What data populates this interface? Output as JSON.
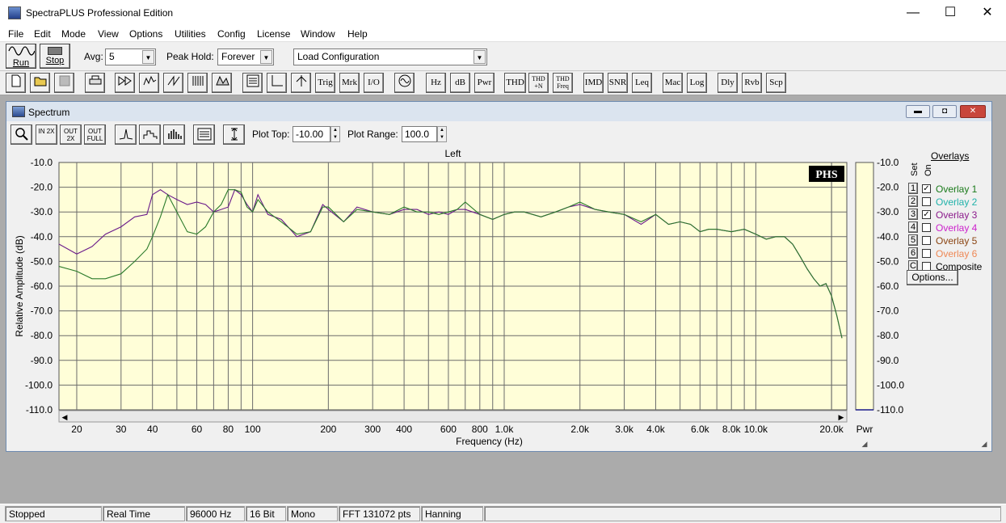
{
  "window": {
    "title": "SpectraPLUS Professional Edition",
    "minimize": "—",
    "maximize": "☐",
    "close": "✕"
  },
  "menu": [
    "File",
    "Edit",
    "Mode",
    "View",
    "Options",
    "Utilities",
    "Config",
    "License",
    "Window",
    "Help"
  ],
  "toolbar": {
    "run_label": "Run",
    "stop_label": "Stop",
    "avg_label": "Avg:",
    "avg_value": "5",
    "peak_hold_label": "Peak Hold:",
    "peak_hold_value": "Forever",
    "config_value": "Load Configuration"
  },
  "toolbar2": {
    "trig": "Trig",
    "mrk": "Mrk",
    "io": "I/O",
    "hz": "Hz",
    "db": "dB",
    "pwr": "Pwr",
    "thd": "THD",
    "thdn": "THD +N",
    "thdfreq": "THD Freq",
    "imd": "IMD",
    "snr": "SNR",
    "leq": "Leq",
    "mac": "Mac",
    "log": "Log",
    "dly": "Dly",
    "rvb": "Rvb",
    "scp": "Scp"
  },
  "spectrum": {
    "title": "Spectrum",
    "plot_top_label": "Plot Top:",
    "plot_top_value": "-10.00",
    "plot_range_label": "Plot Range:",
    "plot_range_value": "100.0",
    "channel_label": "Left",
    "logo": "PHS",
    "pwr_label": "Pwr",
    "zoom_labels": {
      "zin": "IN 2X",
      "zout": "OUT 2X",
      "zfull": "OUT FULL"
    }
  },
  "overlays": {
    "header": "Overlays",
    "set_label": "Set",
    "on_label": "On",
    "options_label": "Options...",
    "items": [
      {
        "num": "1",
        "name": "Overlay 1",
        "checked": true,
        "color": "#1a7a1a"
      },
      {
        "num": "2",
        "name": "Overlay 2",
        "checked": false,
        "color": "#20b2aa"
      },
      {
        "num": "3",
        "name": "Overlay 3",
        "checked": true,
        "color": "#8b1a8b"
      },
      {
        "num": "4",
        "name": "Overlay 4",
        "checked": false,
        "color": "#cc22cc"
      },
      {
        "num": "5",
        "name": "Overlay 5",
        "checked": false,
        "color": "#8b4513"
      },
      {
        "num": "6",
        "name": "Overlay 6",
        "checked": false,
        "color": "#ee8855"
      },
      {
        "num": "C",
        "name": "Composite",
        "checked": false,
        "color": "#000000"
      }
    ]
  },
  "status": [
    "Stopped",
    "Real Time",
    "96000 Hz",
    "16 Bit",
    "Mono",
    "FFT 131072 pts",
    "Hanning"
  ],
  "chart_data": {
    "type": "line",
    "title": "Left",
    "xlabel": "Frequency (Hz)",
    "ylabel": "Relative Amplitude (dB)",
    "xscale": "log",
    "xlim": [
      17,
      23000
    ],
    "ylim": [
      -110,
      -10
    ],
    "x_ticks": [
      "20",
      "30",
      "40",
      "60",
      "80",
      "100",
      "200",
      "300",
      "400",
      "600",
      "800",
      "1.0k",
      "2.0k",
      "3.0k",
      "4.0k",
      "6.0k",
      "8.0k",
      "10.0k",
      "20.0k"
    ],
    "y_ticks": [
      "-10.0",
      "-20.0",
      "-30.0",
      "-40.0",
      "-50.0",
      "-60.0",
      "-70.0",
      "-80.0",
      "-90.0",
      "-100.0",
      "-110.0"
    ],
    "grid": true,
    "background": "#fffed8",
    "series": [
      {
        "name": "Overlay 3",
        "color": "#6a1a8a",
        "x": [
          17,
          20,
          23,
          26,
          30,
          34,
          38,
          40,
          43,
          46,
          50,
          55,
          60,
          65,
          70,
          75,
          80,
          85,
          90,
          95,
          100,
          105,
          115,
          130,
          150,
          170,
          190,
          200,
          230,
          260,
          300,
          350,
          400,
          450,
          500,
          550,
          600,
          650,
          700,
          800,
          900,
          1000,
          1100,
          1200,
          1400,
          1600,
          1800,
          2000,
          2300,
          2600,
          3000,
          3500,
          4000,
          4500,
          5000,
          5500,
          6000,
          6500,
          7000,
          8000,
          9000,
          10000,
          11000,
          12000,
          13000,
          14000,
          15000,
          16000,
          17000,
          18000,
          19000,
          20000,
          21000,
          22000
        ],
        "y": [
          -43,
          -47,
          -44,
          -39,
          -36,
          -32,
          -31,
          -23,
          -21,
          -23,
          -25,
          -27,
          -26,
          -27,
          -30,
          -29,
          -28,
          -21,
          -23,
          -27,
          -30,
          -23,
          -31,
          -33,
          -40,
          -38,
          -27,
          -29,
          -34,
          -28,
          -30,
          -31,
          -29,
          -29,
          -31,
          -30,
          -31,
          -29,
          -29,
          -31,
          -33,
          -31,
          -30,
          -30,
          -32,
          -30,
          -28,
          -27,
          -29,
          -30,
          -31,
          -35,
          -31,
          -35,
          -34,
          -35,
          -38,
          -37,
          -37,
          -38,
          -37,
          -39,
          -41,
          -40,
          -40,
          -43,
          -48,
          -53,
          -57,
          -60,
          -59,
          -64,
          -72,
          -81
        ]
      },
      {
        "name": "Overlay 1",
        "color": "#2a7a2a",
        "x": [
          17,
          20,
          23,
          26,
          30,
          34,
          38,
          40,
          43,
          46,
          50,
          55,
          60,
          65,
          70,
          75,
          80,
          85,
          90,
          95,
          100,
          105,
          115,
          130,
          150,
          170,
          190,
          200,
          230,
          260,
          300,
          350,
          400,
          450,
          500,
          550,
          600,
          650,
          700,
          800,
          900,
          1000,
          1100,
          1200,
          1400,
          1600,
          1800,
          2000,
          2300,
          2600,
          3000,
          3500,
          4000,
          4500,
          5000,
          5500,
          6000,
          6500,
          7000,
          8000,
          9000,
          10000,
          11000,
          12000,
          13000,
          14000,
          15000,
          16000,
          17000,
          18000,
          19000,
          20000,
          21000,
          22000
        ],
        "y": [
          -52,
          -54,
          -57,
          -57,
          -55,
          -50,
          -45,
          -40,
          -32,
          -23,
          -30,
          -38,
          -39,
          -36,
          -30,
          -27,
          -21,
          -21,
          -22,
          -28,
          -30,
          -25,
          -30,
          -34,
          -39,
          -38,
          -28,
          -28,
          -34,
          -29,
          -30,
          -31,
          -28,
          -30,
          -30,
          -31,
          -30,
          -29,
          -26,
          -31,
          -33,
          -31,
          -30,
          -30,
          -32,
          -30,
          -28,
          -26,
          -29,
          -30,
          -31,
          -34,
          -31,
          -35,
          -34,
          -35,
          -38,
          -37,
          -37,
          -38,
          -37,
          -39,
          -41,
          -40,
          -40,
          -43,
          -48,
          -53,
          -57,
          -60,
          -59,
          -64,
          -72,
          -81
        ]
      }
    ]
  }
}
